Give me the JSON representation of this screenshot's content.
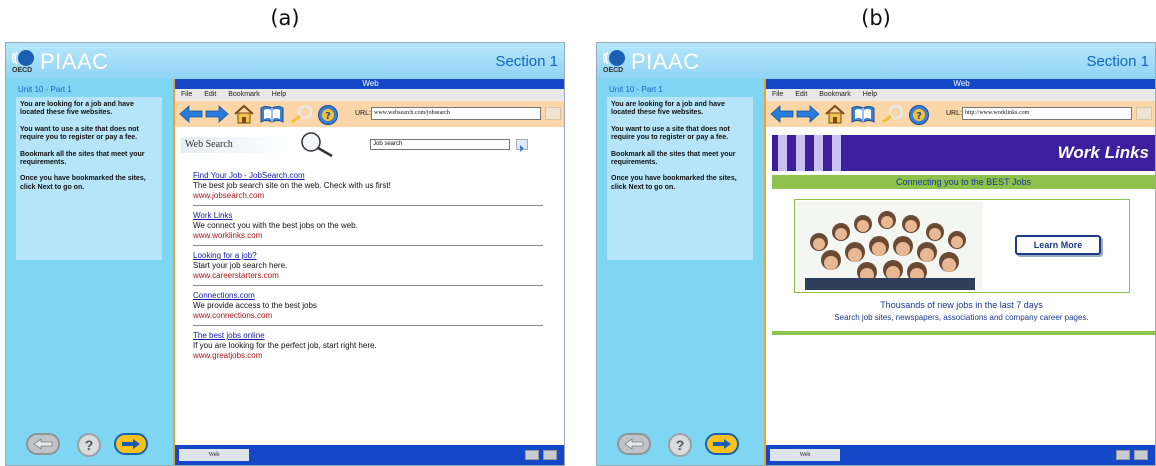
{
  "panels": [
    {
      "label": "(a)",
      "app": {
        "logo_oecd": "OECD",
        "logo_text": "PIAAC",
        "section": "Section 1"
      },
      "left": {
        "unit": "Unit 10 - Part 1",
        "instructions": [
          "You are looking for a job and have located these five websites.",
          "You want to use a site that does not require you to register or pay a fee.",
          "Bookmark all the sites that meet your requirements.",
          "Once you have bookmarked the sites, click Next to go on."
        ],
        "help_label": "?"
      },
      "browser": {
        "title": "Web",
        "menu": [
          "File",
          "Edit",
          "Bookmark",
          "Help"
        ],
        "url_label": "URL:",
        "url": "www.websearch.com/jobsearch",
        "status_tab": "Web"
      }
    },
    {
      "label": "(b)",
      "app": {
        "logo_oecd": "OECD",
        "logo_text": "PIAAC",
        "section": "Section 1"
      },
      "left": {
        "unit": "Unit 10 - Part 1",
        "instructions": [
          "You are looking for a job and have located these five websites.",
          "You want to use a site that does not require you to register or pay a fee.",
          "Bookmark all the sites that meet your requirements.",
          "Once you have bookmarked the sites, click Next to go on."
        ],
        "help_label": "?"
      },
      "browser": {
        "title": "Web",
        "menu": [
          "File",
          "Edit",
          "Bookmark",
          "Help"
        ],
        "url_label": "URL:",
        "url": "http://www.worklinks.com",
        "status_tab": "Web"
      }
    }
  ],
  "websearch": {
    "logo": "Web Search",
    "query": "Job search",
    "results": [
      {
        "title": "Find Your Job - JobSearch.com",
        "desc": "The best job search site on the web.  Check with us first!",
        "url": "www.jobsearch.com"
      },
      {
        "title": "Work Links",
        "desc": "We connect you with the best jobs on the web.",
        "url": "www.worklinks.com"
      },
      {
        "title": "Looking for a job?",
        "desc": "Start your job search here.",
        "url": "www.careerstarters.com"
      },
      {
        "title": "Connections.com",
        "desc": "We provide access to the best jobs",
        "url": "www.connections.com"
      },
      {
        "title": "The best jobs online",
        "desc": "If you are looking for the perfect job, start right here.",
        "url": "www.greatjobs.com"
      }
    ]
  },
  "worklinks": {
    "title": "Work Links",
    "tagline": "Connecting you to the BEST Jobs",
    "button": "Learn More",
    "jobs_line": "Thousands of new jobs in the last 7 days",
    "search_line": "Search job sites, newspapers, associations and company career pages."
  },
  "colors": {
    "header": "#8fd4f5",
    "browser_bar": "#1448c8",
    "toolbar": "#fbd6a8",
    "banner": "#3c1e9e",
    "green": "#8ec24c",
    "next": "#f6c21b"
  }
}
